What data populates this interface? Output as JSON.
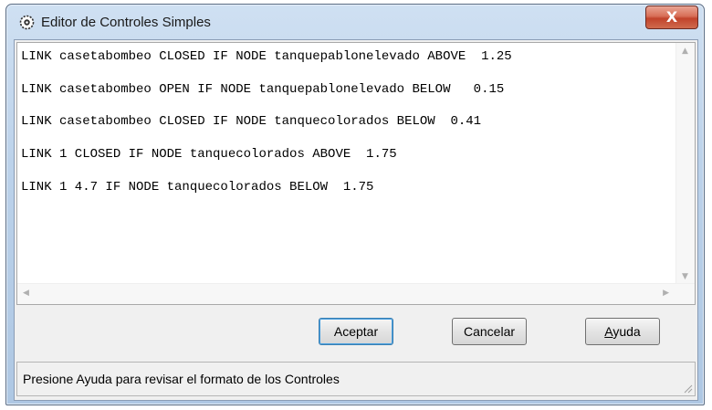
{
  "window": {
    "title": "Editor de Controles Simples",
    "close_label": "X"
  },
  "editor": {
    "lines": [
      "LINK casetabombeo CLOSED IF NODE tanquepablonelevado ABOVE  1.25",
      "LINK casetabombeo OPEN IF NODE tanquepablonelevado BELOW   0.15",
      "LINK casetabombeo CLOSED IF NODE tanquecolorados BELOW  0.41",
      "LINK 1 CLOSED IF NODE tanquecolorados ABOVE  1.75",
      "LINK 1 4.7 IF NODE tanquecolorados BELOW  1.75"
    ]
  },
  "buttons": {
    "accept": "Aceptar",
    "cancel": "Cancelar",
    "help_first": "A",
    "help_rest": "yuda"
  },
  "status": {
    "text": "Presione Ayuda para revisar el formato de los Controles"
  }
}
